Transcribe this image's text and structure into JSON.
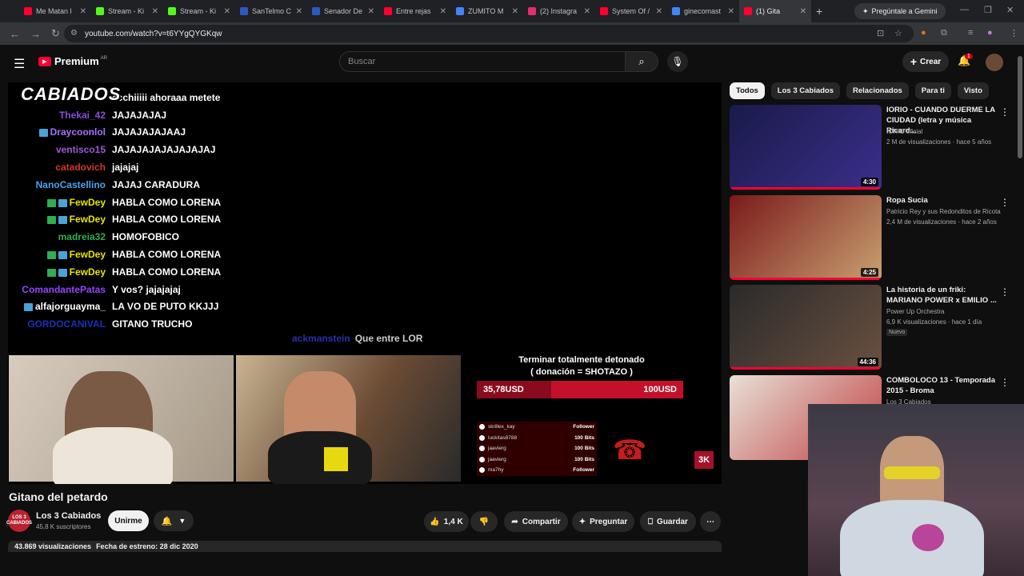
{
  "browser": {
    "tabs": [
      {
        "title": "Me Matan l",
        "color": "#ff0033"
      },
      {
        "title": "Stream - Ki",
        "color": "#53fc18"
      },
      {
        "title": "Stream - Ki",
        "color": "#53fc18"
      },
      {
        "title": "SanTelmo C",
        "color": "#2b59c3"
      },
      {
        "title": "Senador De",
        "color": "#2b59c3"
      },
      {
        "title": "Entre rejas",
        "color": "#ff0033"
      },
      {
        "title": "ZUMITO M",
        "color": "#4285f4"
      },
      {
        "title": "(2) Instagra",
        "color": "#e1306c"
      },
      {
        "title": "System Of /",
        "color": "#ff0033"
      },
      {
        "title": "ginecomast",
        "color": "#4285f4"
      },
      {
        "title": "(1) Gita",
        "color": "#ff0033"
      }
    ],
    "gemini_label": "Pregúntale a Gemini",
    "url": "youtube.com/watch?v=t6YYgQYGKqw"
  },
  "youtube": {
    "brand": "Premium",
    "region": "AR",
    "search_placeholder": "Buscar",
    "create_label": "Crear",
    "notif_count": "1"
  },
  "stream": {
    "overlay_logo": "CABIADOS",
    "chat": [
      {
        "user": "",
        "color": "#ffffff",
        "msg": "ccchiiiii ahoraaa metete",
        "badges": 0
      },
      {
        "user": "Thekai_42",
        "color": "#8a4fd8",
        "msg": "JAJAJAJAJ",
        "badges": 0
      },
      {
        "user": "Draycoonlol",
        "color": "#a970ff",
        "msg": "JAJAJAJAJAAJ",
        "badges": 1
      },
      {
        "user": "ventisco15",
        "color": "#9b59d8",
        "msg": "JAJAJAJAJAJAJAJAJ",
        "badges": 0
      },
      {
        "user": "catadovich",
        "color": "#d2362f",
        "msg": "jajajaj",
        "badges": 0
      },
      {
        "user": "NanoCastellino",
        "color": "#4aa3f0",
        "msg": "JAJAJ CARADURA",
        "badges": 0
      },
      {
        "user": "FewDey",
        "color": "#e6e600",
        "msg": "HABLA COMO LORENA",
        "badges": 2
      },
      {
        "user": "FewDey",
        "color": "#e6e600",
        "msg": "HABLA COMO LORENA",
        "badges": 2
      },
      {
        "user": "madreia32",
        "color": "#2fae52",
        "msg": "HOMOFOBICO",
        "badges": 0
      },
      {
        "user": "FewDey",
        "color": "#e6e600",
        "msg": "HABLA COMO LORENA",
        "badges": 2
      },
      {
        "user": "FewDey",
        "color": "#e6e600",
        "msg": "HABLA COMO LORENA",
        "badges": 2
      },
      {
        "user": "ComandantePatas",
        "color": "#9146ff",
        "msg": "Y vos? jajajajaj",
        "badges": 0
      },
      {
        "user": "alfajorguayma_",
        "color": "#ffffff",
        "msg": "LA VO DE PUTO KKJJJ",
        "badges": 1
      },
      {
        "user": "GORDOCANIVAL",
        "color": "#1b2fb8",
        "msg": "GITANO TRUCHO",
        "badges": 0
      }
    ],
    "chat_last": {
      "user": "ackmanstein",
      "color": "#2a2fa8",
      "msg": "Que entre LOR"
    },
    "goal_text_1": "Terminar totalmente detonado",
    "goal_text_2": "( donación = SHOTAZO )",
    "goal_current": "35,78USD",
    "goal_target": "100USD",
    "goal_fraction": 0.36,
    "events": [
      {
        "name": "skrillex_kay",
        "type": "Follower"
      },
      {
        "name": "luckitas8788",
        "type": "100 Bits"
      },
      {
        "name": "jaavierg",
        "type": "100 Bits"
      },
      {
        "name": "jaavierg",
        "type": "100 Bits"
      },
      {
        "name": "ma7hy",
        "type": "Follower"
      }
    ],
    "bits_label": "3K"
  },
  "video": {
    "title": "Gitano del petardo",
    "channel": "Los 3 Cabiados",
    "channel_avatar_text": "LOS 3 CABIADOS",
    "subscribers": "45,8 K suscriptores",
    "join_label": "Unirme",
    "likes": "1,4 K",
    "share_label": "Compartir",
    "ask_label": "Preguntar",
    "save_label": "Guardar",
    "views": "43.869 visualizaciones",
    "premiere": "Fecha de estreno: 28 dic 2020"
  },
  "sidebar": {
    "chips": [
      "Todos",
      "Los 3 Cabiados",
      "Relacionados",
      "Para ti",
      "Visto"
    ],
    "recs": [
      {
        "title": "IORIO - CUANDO DUERME LA CIUDAD (letra y música Ricard...",
        "channel": "IORIO oficial",
        "meta": "2 M de visualizaciones · hace 5 años",
        "duration": "4:30",
        "colors": [
          "#1a1a4a",
          "#3a2f8a"
        ],
        "new": ""
      },
      {
        "title": "Ropa Sucia",
        "channel": "Patricio Rey y sus Redonditos de Ricota",
        "meta": "2,4 M de visualizaciones · hace 2 años",
        "duration": "4:25",
        "colors": [
          "#7a1a1a",
          "#c8a070"
        ],
        "new": ""
      },
      {
        "title": "La historia de un friki: MARIANO POWER x EMILIO ...",
        "channel": "Power Up Orchestra",
        "meta": "6,9 K visualizaciones · hace 1 día",
        "duration": "44:36",
        "colors": [
          "#2a2a2a",
          "#6a5040"
        ],
        "new": "Nuevo"
      },
      {
        "title": "COMBOLOCO 13 - Temporada 2015 - Broma",
        "channel": "Los 3 Cabiados",
        "meta": "",
        "duration": "",
        "colors": [
          "#e8e0d8",
          "#c04040"
        ],
        "new": ""
      }
    ]
  }
}
